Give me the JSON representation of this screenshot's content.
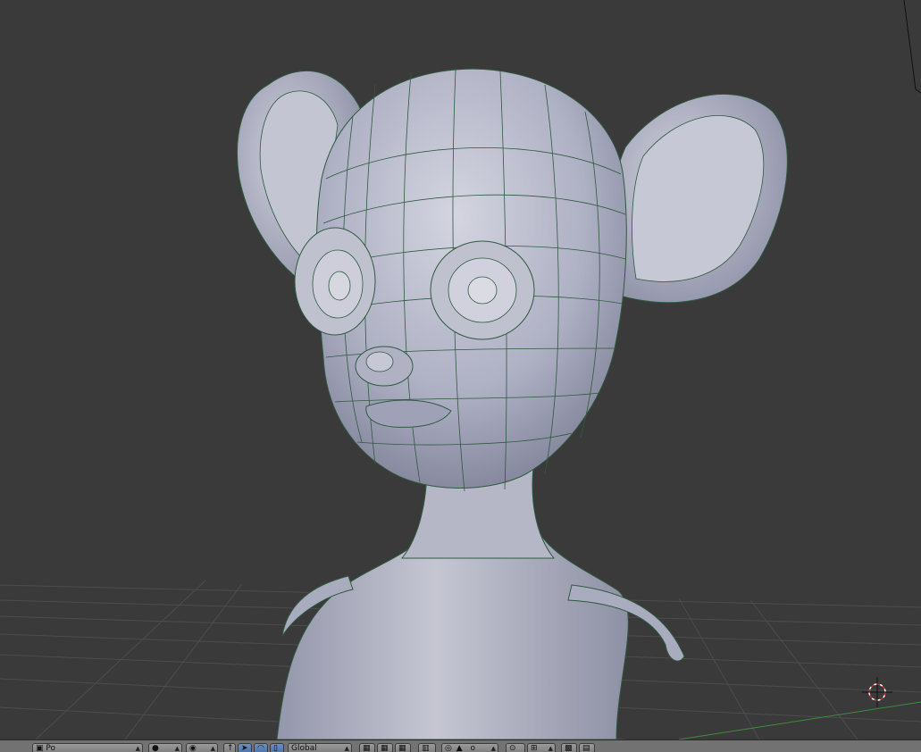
{
  "viewport": {
    "background": "#3a3a3a",
    "mesh_fill": "#b8b9c8",
    "wire_color": "#2f5a3f",
    "grid_color": "#4a4a4a",
    "x_axis_color": "#3f8a3f",
    "cursor_color": "#c83232"
  },
  "header": {
    "mode_label": "Po",
    "pivot_label": "Global",
    "layer_label": "o"
  }
}
